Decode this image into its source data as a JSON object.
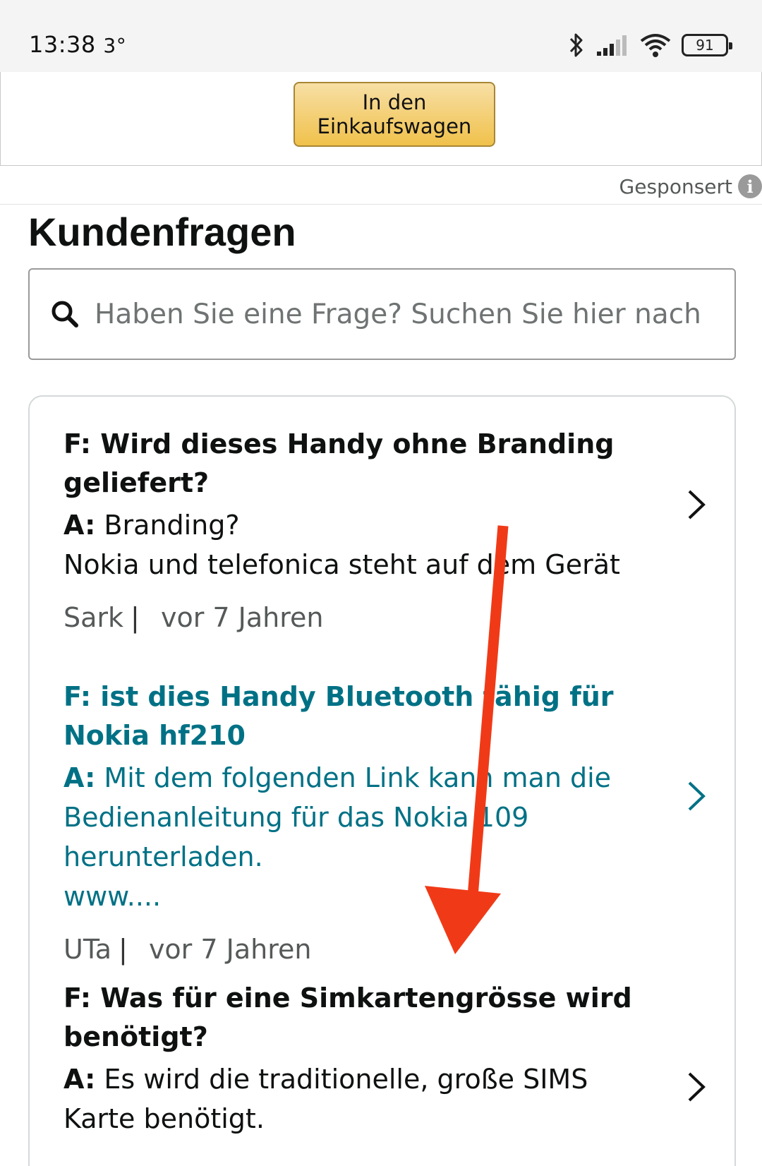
{
  "status_bar": {
    "time": "13:38",
    "temperature": "3°",
    "battery_level": "91",
    "icons": [
      "bluetooth-icon",
      "signal-icon",
      "wifi-icon",
      "battery-icon"
    ]
  },
  "ad": {
    "cart_button_line1": "In den",
    "cart_button_line2": "Einkaufswagen",
    "sponsored_label": "Gesponsert"
  },
  "questions_section": {
    "title": "Kundenfragen",
    "search_placeholder": "Haben Sie eine Frage? Suchen Sie hier nach",
    "items": [
      {
        "question": "F: Wird dieses Handy ohne Branding geliefert?",
        "answer_prefix": "A:",
        "answer_line1": "Branding?",
        "answer_line2": "Nokia und telefonica steht auf dem Gerät",
        "author": "Sark",
        "date": "vor 7 Jahren"
      },
      {
        "question": "F: ist dies Handy Bluetooth fähig für Nokia hf210",
        "answer_prefix": "A:",
        "answer_text": "Mit dem folgenden Link kann man die Bedienanleitung für das Nokia 109 herunterladen.",
        "answer_link": "www....",
        "author": "UTa",
        "date": "vor 7 Jahren"
      },
      {
        "question": "F: Was für eine Simkartengrösse wird benötigt?",
        "answer_prefix": "A:",
        "answer_text": "Es wird die traditionelle, große SIMS Karte benötigt."
      }
    ]
  },
  "colors": {
    "accent_teal": "#007185",
    "cart_button": "#f0c14b",
    "annotation_arrow": "#f03a17"
  }
}
